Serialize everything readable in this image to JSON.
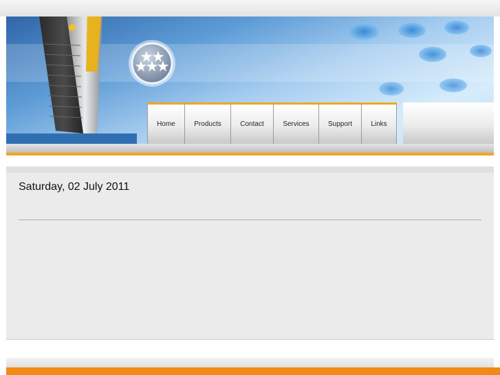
{
  "nav": {
    "items": [
      {
        "label": "Home"
      },
      {
        "label": "Products"
      },
      {
        "label": "Contact"
      },
      {
        "label": "Services"
      },
      {
        "label": "Support"
      },
      {
        "label": "Links"
      }
    ]
  },
  "content": {
    "date": "Saturday, 02 July 2011"
  },
  "colors": {
    "accent": "#f3a521",
    "footer": "#f08a14",
    "content_bg": "#ebebeb"
  },
  "icons": {
    "banner_graphic": "server-tower",
    "logo_badge": "stars-badge"
  }
}
